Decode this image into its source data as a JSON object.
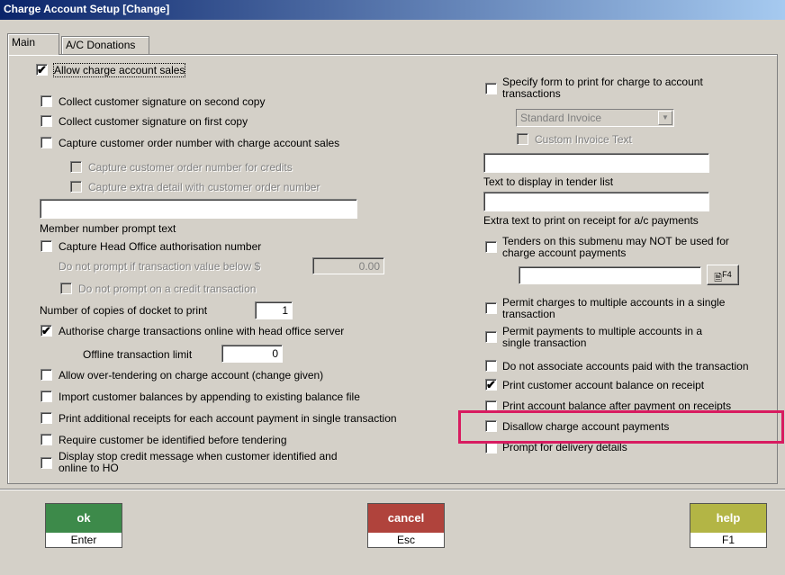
{
  "window": {
    "title": "Charge Account Setup  [Change]"
  },
  "tabs": [
    {
      "label": "Main"
    },
    {
      "label": "A/C Donations"
    }
  ],
  "left": {
    "allow_sales": {
      "label": "Allow charge account sales",
      "checked": true
    },
    "sig_second": {
      "label": "Collect customer signature on second copy",
      "checked": false
    },
    "sig_first": {
      "label": "Collect customer signature on first copy",
      "checked": false
    },
    "order_number": {
      "label": "Capture customer order number with charge account sales",
      "checked": false
    },
    "order_credits": {
      "label": "Capture customer order number for credits",
      "checked": false
    },
    "extra_detail": {
      "label": "Capture extra detail with customer order number",
      "checked": false
    },
    "member_prompt": {
      "value": "",
      "label": "Member number prompt text"
    },
    "head_office_auth": {
      "label": "Capture Head Office authorisation number",
      "checked": false
    },
    "no_prompt_below": {
      "label": "Do not prompt if transaction value below $",
      "value": "0.00"
    },
    "no_prompt_credit": {
      "label": "Do not prompt on a credit transaction",
      "checked": false
    },
    "docket_copies": {
      "label": "Number of copies of docket to print",
      "value": "1"
    },
    "authorise_online": {
      "label": "Authorise charge transactions online with head office server",
      "checked": true
    },
    "offline_limit": {
      "label": "Offline transaction limit",
      "value": "0"
    },
    "over_tender": {
      "label": "Allow over-tendering on charge account (change given)",
      "checked": false
    },
    "import_balances": {
      "label": "Import customer balances by appending to existing balance file",
      "checked": false
    },
    "additional_receipts": {
      "label": "Print additional receipts for each account payment in single transaction",
      "checked": false
    },
    "require_identified": {
      "label": "Require customer be identified before tendering",
      "checked": false
    },
    "stop_credit": {
      "label": "Display stop credit message when customer identified and online to HO",
      "checked": false
    }
  },
  "right": {
    "specify_form": {
      "label": "Specify form to print for charge to account transactions",
      "checked": false
    },
    "invoice_select": {
      "value": "Standard Invoice"
    },
    "custom_invoice": {
      "label": "Custom Invoice Text",
      "checked": false
    },
    "tender_text": {
      "value": "",
      "label": "Text to display in tender list"
    },
    "extra_text": {
      "value": "",
      "label": "Extra text to print on receipt for a/c payments"
    },
    "submenu_tenders": {
      "label": "Tenders on this submenu may NOT be used for charge account payments",
      "checked": false
    },
    "submenu_value": "",
    "f4_button": "F4",
    "multi_charges": {
      "label": "Permit charges to multiple accounts in a single transaction",
      "checked": false
    },
    "multi_payments": {
      "label": "Permit payments to multiple accounts in a single transaction",
      "checked": false
    },
    "no_associate": {
      "label": "Do not associate accounts paid with the transaction",
      "checked": false
    },
    "print_balance": {
      "label": "Print customer account balance on receipt",
      "checked": true
    },
    "balance_after": {
      "label": "Print account balance after payment on receipts",
      "checked": false
    },
    "disallow_payments": {
      "label": "Disallow charge account payments",
      "checked": false
    },
    "delivery_details": {
      "label": "Prompt for delivery details",
      "checked": false
    }
  },
  "buttons": {
    "ok": {
      "label": "ok",
      "key": "Enter",
      "color": "#3d8a4a"
    },
    "cancel": {
      "label": "cancel",
      "key": "Esc",
      "color": "#b0433c"
    },
    "help": {
      "label": "help",
      "key": "F1",
      "color": "#b3b545"
    }
  },
  "highlight_color": "#d81b60"
}
